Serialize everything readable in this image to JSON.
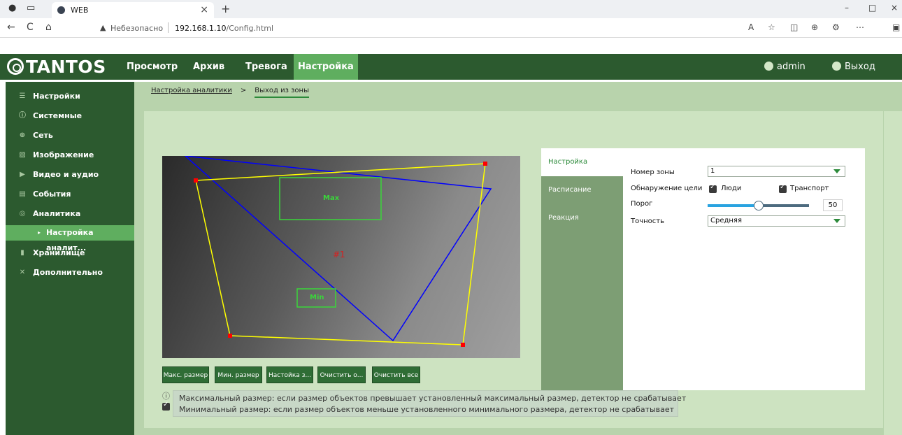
{
  "browser": {
    "tab_title": "WEB",
    "close_tab": "×",
    "new_tab": "+",
    "back": "←",
    "reload": "C",
    "home": "⌂",
    "insecure_label": "Небезопасно",
    "url_host": "192.168.1.10",
    "url_path": "/Config.html",
    "window_min": "–",
    "window_max": "□",
    "window_close": "×"
  },
  "app": {
    "brand": "TANTOS",
    "nav": [
      "Просмотр",
      "Архив",
      "Тревога",
      "Настройка"
    ],
    "active_nav": "Настройка",
    "user": "admin",
    "logout": "Выход"
  },
  "sidebar": {
    "items": [
      {
        "label": "Настройки",
        "icon": "list-icon"
      },
      {
        "label": "Системные",
        "icon": "info-icon"
      },
      {
        "label": "Сеть",
        "icon": "globe-icon"
      },
      {
        "label": "Изображение",
        "icon": "image-icon"
      },
      {
        "label": "Видео и аудио",
        "icon": "video-icon"
      },
      {
        "label": "События",
        "icon": "events-icon"
      },
      {
        "label": "Аналитика",
        "icon": "analytics-icon"
      },
      {
        "label": "Хранилище",
        "icon": "storage-icon"
      },
      {
        "label": "Дополнительно",
        "icon": "wrench-icon"
      }
    ],
    "sub_item": "Настройка аналит..."
  },
  "breadcrumb": {
    "link": "Настройка аналитики",
    "sep": ">",
    "current": "Выход из зоны"
  },
  "video": {
    "max_label": "Max",
    "min_label": "Min",
    "zone_label": "#1"
  },
  "buttons": [
    "Макс. размер",
    "Мин. размер",
    "Настойка з...",
    "Очистить о...",
    "Очистить все"
  ],
  "info": {
    "line1": "Максимальный размер: если размер объектов превышает установленный максимальный размер, детектор не срабатывает",
    "line2": "Минимальный размер: если размер объектов меньше установленного минимального размера, детектор не срабатывает"
  },
  "settings": {
    "tabs": [
      "Настройка",
      "Расписание",
      "Реакция"
    ],
    "zone_number_label": "Номер зоны",
    "zone_number_value": "1",
    "target_label": "Обнаружение цели",
    "people_label": "Люди",
    "vehicle_label": "Транспорт",
    "threshold_label": "Порог",
    "threshold_value": "50",
    "threshold_fraction": 0.5,
    "accuracy_label": "Точность",
    "accuracy_value": "Средняя"
  },
  "colors": {
    "brand_green": "#2c5a2f",
    "active_green": "#5fae5f",
    "panel_bg": "#b8d3ac",
    "zone_yellow": "#ffff00",
    "zone_blue": "#0000ff",
    "box_green": "#3ad63a"
  }
}
